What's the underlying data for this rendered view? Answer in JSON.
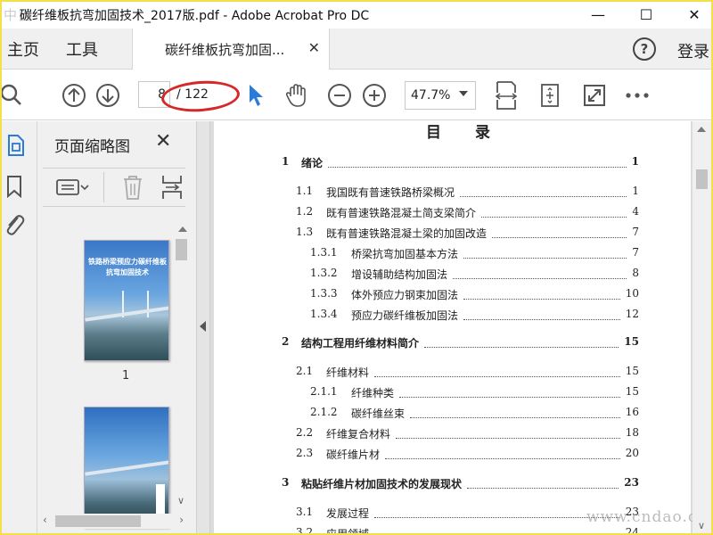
{
  "window": {
    "title": "碳纤维板抗弯加固技术_2017版.pdf - Adobe Acrobat Pro DC",
    "watermark_corner": "中国",
    "minimize": "—",
    "maximize": "☐",
    "close": "✕"
  },
  "tabs": {
    "home": "主页",
    "tools": "工具",
    "doc_tab": "碳纤维板抗弯加固...",
    "doc_tab_close": "✕",
    "help": "?",
    "login": "登录"
  },
  "toolbar": {
    "current_page": "8",
    "page_count": "/ 122",
    "zoom": "47.7%"
  },
  "panel": {
    "title": "页面缩略图",
    "close": "✕",
    "thumb1_title": "铁路桥梁预应力碳纤维板抗弯加固技术",
    "thumb1_page": "1"
  },
  "toc": {
    "title": "目录",
    "entries": [
      {
        "no": "1",
        "text": "绪论",
        "page": "1",
        "level": 0
      },
      {
        "no": "1.1",
        "text": "我国既有普速铁路桥梁概况",
        "page": "1",
        "level": 1
      },
      {
        "no": "1.2",
        "text": "既有普速铁路混凝土简支梁简介",
        "page": "4",
        "level": 1
      },
      {
        "no": "1.3",
        "text": "既有普速铁路混凝土梁的加固改造",
        "page": "7",
        "level": 1
      },
      {
        "no": "1.3.1",
        "text": "桥梁抗弯加固基本方法",
        "page": "7",
        "level": 2
      },
      {
        "no": "1.3.2",
        "text": "增设辅助结构加固法",
        "page": "8",
        "level": 2
      },
      {
        "no": "1.3.3",
        "text": "体外预应力钢束加固法",
        "page": "10",
        "level": 2
      },
      {
        "no": "1.3.4",
        "text": "预应力碳纤维板加固法",
        "page": "12",
        "level": 2
      },
      {
        "no": "2",
        "text": "结构工程用纤维材料简介",
        "page": "15",
        "level": 0
      },
      {
        "no": "2.1",
        "text": "纤维材料",
        "page": "15",
        "level": 1
      },
      {
        "no": "2.1.1",
        "text": "纤维种类",
        "page": "15",
        "level": 2
      },
      {
        "no": "2.1.2",
        "text": "碳纤维丝束",
        "page": "16",
        "level": 2
      },
      {
        "no": "2.2",
        "text": "纤维复合材料",
        "page": "18",
        "level": 1
      },
      {
        "no": "2.3",
        "text": "碳纤维片材",
        "page": "20",
        "level": 1
      },
      {
        "no": "3",
        "text": "粘贴纤维片材加固技术的发展现状",
        "page": "23",
        "level": 0
      },
      {
        "no": "3.1",
        "text": "发展过程",
        "page": "23",
        "level": 1
      },
      {
        "no": "3.2",
        "text": "应用领域",
        "page": "24",
        "level": 1
      }
    ]
  },
  "site_watermark": "www.cndao.com",
  "colors": {
    "accent_blue": "#2b79d8",
    "annotation_red": "#d62828",
    "frame_yellow": "#f5e04a"
  },
  "icons": [
    "search-icon",
    "prev-page-icon",
    "next-page-icon",
    "select-cursor-icon",
    "hand-tool-icon",
    "zoom-out-icon",
    "zoom-in-icon",
    "fit-page-icon",
    "rotate-icon",
    "fullscreen-icon",
    "more-icon",
    "page-thumbnails-icon",
    "bookmark-icon",
    "attachment-icon",
    "thumbnail-options-icon",
    "delete-icon",
    "insert-page-icon"
  ]
}
